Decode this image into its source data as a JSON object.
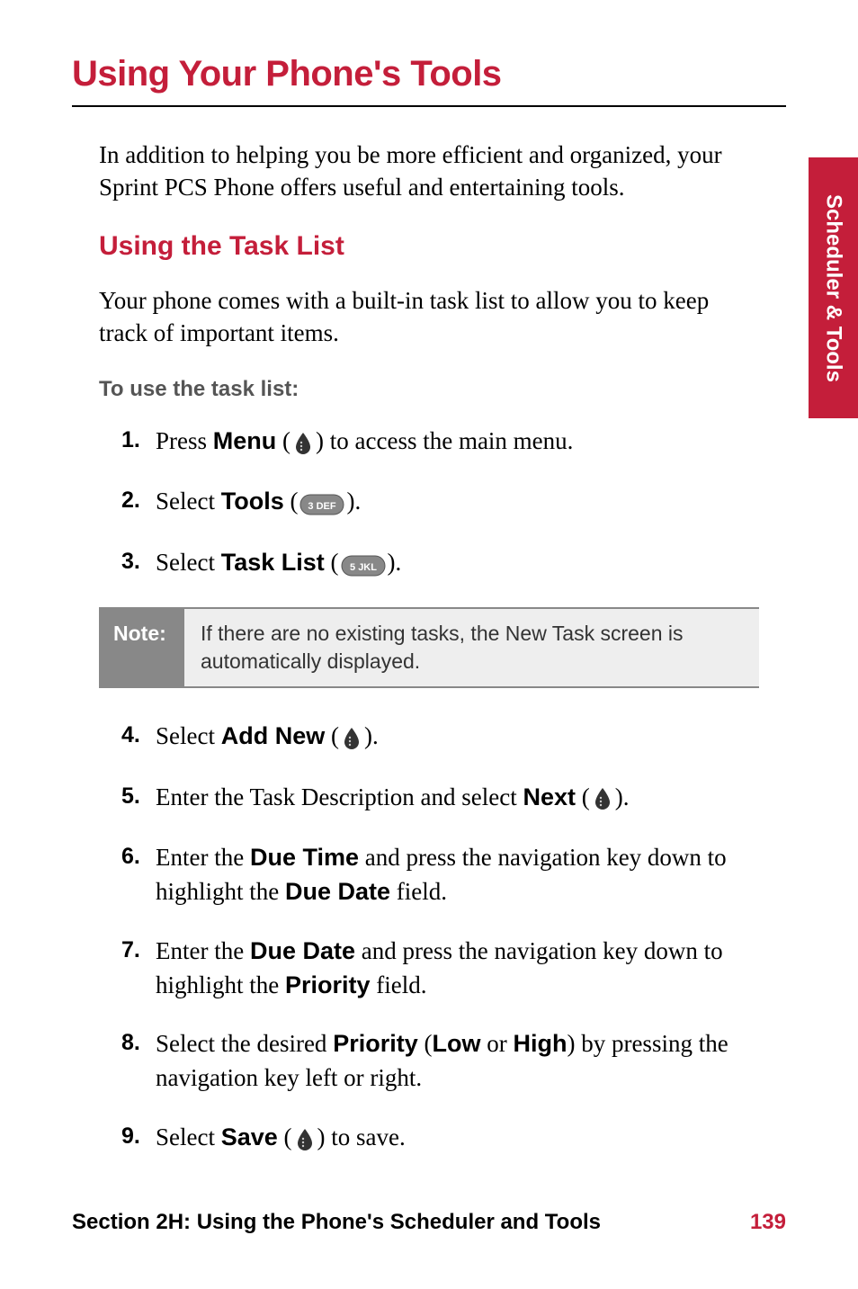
{
  "sideTab": "Scheduler & Tools",
  "title": "Using Your Phone's Tools",
  "intro": "In addition to helping you be more efficient and organized, your Sprint PCS Phone offers useful and entertaining tools.",
  "section": {
    "heading": "Using the Task List",
    "desc": "Your phone comes with a built-in task list to allow you to keep track of important items.",
    "instructionLabel": "To use the task list:"
  },
  "stepsTop": [
    {
      "num": "1.",
      "prefix": "Press ",
      "bold": "Menu",
      "paren_open": " (",
      "icon": "teardrop",
      "paren_close": ") to access the main menu."
    },
    {
      "num": "2.",
      "prefix": "Select ",
      "bold": "Tools",
      "paren_open": " (",
      "icon": "key3",
      "paren_close": ")."
    },
    {
      "num": "3.",
      "prefix": "Select ",
      "bold": "Task List",
      "paren_open": " (",
      "icon": "key5",
      "paren_close": ")."
    }
  ],
  "note": {
    "label": "Note:",
    "text": "If there are no existing tasks, the New Task screen is automatically displayed."
  },
  "stepsBottom": [
    {
      "num": "4.",
      "parts": [
        {
          "t": "Select "
        },
        {
          "b": "Add New"
        },
        {
          "t": " ("
        },
        {
          "icon": "teardrop"
        },
        {
          "t": ")."
        }
      ]
    },
    {
      "num": "5.",
      "parts": [
        {
          "t": "Enter the Task Description and select "
        },
        {
          "b": "Next"
        },
        {
          "t": " ("
        },
        {
          "icon": "teardrop"
        },
        {
          "t": ")."
        }
      ]
    },
    {
      "num": "6.",
      "parts": [
        {
          "t": "Enter the "
        },
        {
          "b": "Due Time"
        },
        {
          "t": " and press the navigation key down to highlight the "
        },
        {
          "b": "Due Date"
        },
        {
          "t": " field."
        }
      ]
    },
    {
      "num": "7.",
      "parts": [
        {
          "t": "Enter the "
        },
        {
          "b": "Due Date"
        },
        {
          "t": " and press the navigation key down to highlight the "
        },
        {
          "b": "Priority"
        },
        {
          "t": " field."
        }
      ]
    },
    {
      "num": "8.",
      "parts": [
        {
          "t": "Select the desired "
        },
        {
          "b": "Priority"
        },
        {
          "t": " ("
        },
        {
          "b": "Low"
        },
        {
          "t": " or "
        },
        {
          "b": "High"
        },
        {
          "t": ") by pressing the navigation key left or right."
        }
      ]
    },
    {
      "num": "9.",
      "parts": [
        {
          "t": "Select "
        },
        {
          "b": "Save"
        },
        {
          "t": " ("
        },
        {
          "icon": "teardrop"
        },
        {
          "t": ") to save."
        }
      ]
    }
  ],
  "footer": {
    "section": "Section 2H: Using the Phone's Scheduler and Tools",
    "page": "139"
  },
  "icons": {
    "key3_label": "3 DEF",
    "key5_label": "5 JKL"
  }
}
